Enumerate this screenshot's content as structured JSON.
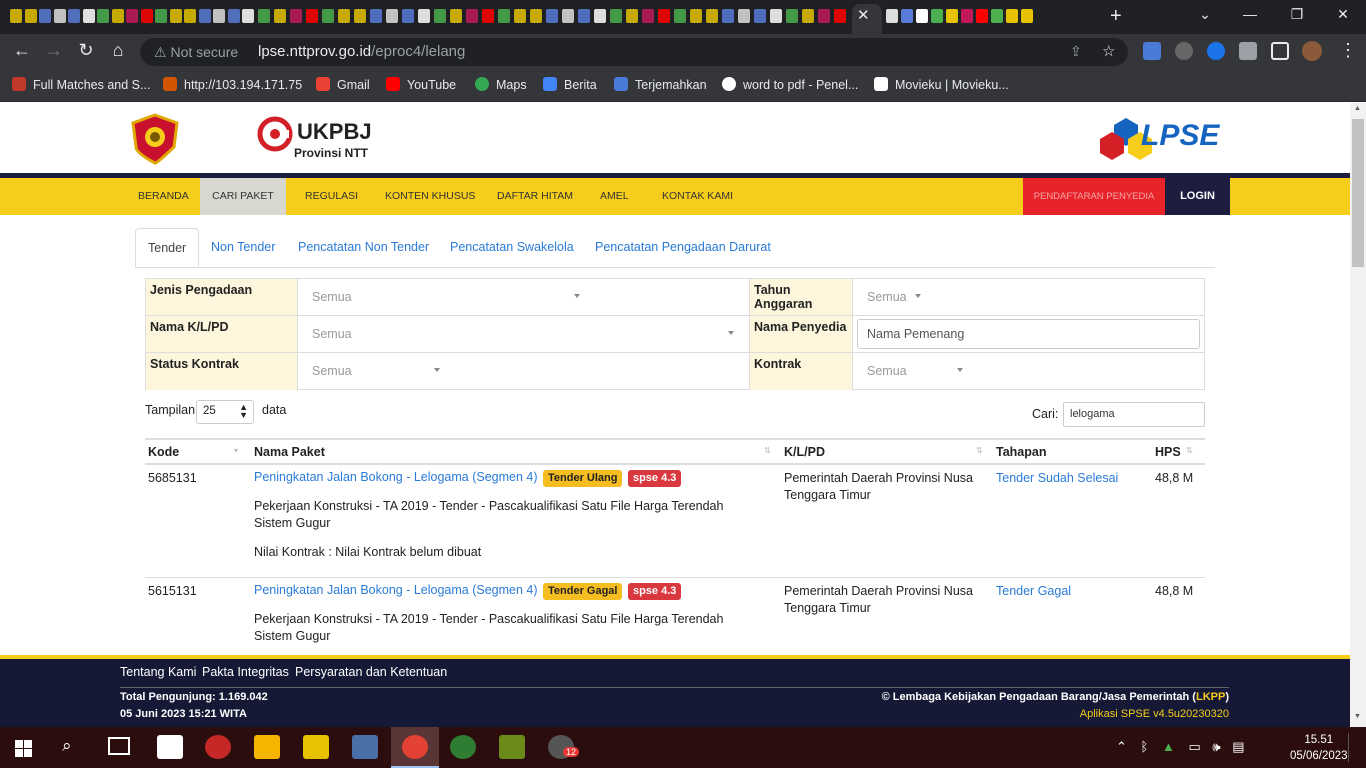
{
  "browser": {
    "not_secure": "Not secure",
    "url_host": "lpse.nttprov.go.id",
    "url_path": "/eproc4/lelang",
    "bookmarks": [
      "Full Matches and S...",
      "http://103.194.171.75",
      "Gmail",
      "YouTube",
      "Maps",
      "Berita",
      "Terjemahkan",
      "word to pdf - Penel...",
      "Movieku | Movieku..."
    ]
  },
  "header": {
    "ukpbj_title": "UKPBJ",
    "ukpbj_sub": "Provinsi NTT",
    "lpse_title": "LPSE"
  },
  "nav": {
    "items": [
      "BERANDA",
      "CARI PAKET",
      "REGULASI",
      "KONTEN KHUSUS",
      "DAFTAR HITAM",
      "AMEL",
      "KONTAK KAMI"
    ],
    "register": "PENDAFTARAN PENYEDIA",
    "login": "LOGIN"
  },
  "tabs": [
    "Tender",
    "Non Tender",
    "Pencatatan Non Tender",
    "Pencatatan Swakelola",
    "Pencatatan Pengadaan Darurat"
  ],
  "filters": {
    "jenis_label": "Jenis Pengadaan",
    "jenis_value": "Semua",
    "tahun_label": "Tahun Anggaran",
    "tahun_value": "Semua",
    "nama_klpd_label": "Nama K/L/PD",
    "nama_klpd_value": "Semua",
    "penyedia_label": "Nama Penyedia",
    "penyedia_placeholder": "Nama Pemenang",
    "status_label": "Status Kontrak",
    "status_value": "Semua",
    "kontrak_label": "Kontrak",
    "kontrak_value": "Semua"
  },
  "list": {
    "tampilan_label": "Tampilan",
    "tampilan_value": "25",
    "data_label": "data",
    "cari_label": "Cari:",
    "cari_value": "lelogama"
  },
  "table": {
    "headers": [
      "Kode",
      "Nama Paket",
      "K/L/PD",
      "Tahapan",
      "HPS"
    ],
    "rows": [
      {
        "kode": "5685131",
        "nama": "Peningkatan Jalan Bokong - Lelogama (Segmen 4)",
        "badge1": "Tender Ulang",
        "badge2": "spse 4.3",
        "desc": "Pekerjaan Konstruksi - TA 2019 - Tender - Pascakualifikasi Satu File Harga Terendah Sistem Gugur",
        "nilai": "Nilai Kontrak : Nilai Kontrak belum dibuat",
        "klpd": "Pemerintah Daerah Provinsi Nusa Tenggara Timur",
        "tahapan": "Tender Sudah Selesai",
        "hps": "48,8 M"
      },
      {
        "kode": "5615131",
        "nama": "Peningkatan Jalan Bokong - Lelogama (Segmen 4)",
        "badge1": "Tender Gagal",
        "badge2": "spse 4.3",
        "desc": "Pekerjaan Konstruksi - TA 2019 - Tender - Pascakualifikasi Satu File Harga Terendah Sistem Gugur",
        "klpd": "Pemerintah Daerah Provinsi Nusa Tenggara Timur",
        "tahapan": "Tender Gagal",
        "hps": "48,8 M"
      }
    ]
  },
  "footer": {
    "links": [
      "Tentang Kami",
      "Pakta Integritas",
      "Persyaratan dan Ketentuan"
    ],
    "visitors": "Total Pengunjung: 1.169.042",
    "datetime": "05 Juni 2023 15:21 WITA",
    "copyright": "© Lembaga Kebijakan Pengadaan Barang/Jasa Pemerintah (",
    "lkpp": "LKPP",
    "copyright_end": ")",
    "version": "Aplikasi SPSE v4.5u20230320"
  },
  "taskbar": {
    "time": "15.51",
    "date": "05/06/2023",
    "notif_count": "12"
  }
}
